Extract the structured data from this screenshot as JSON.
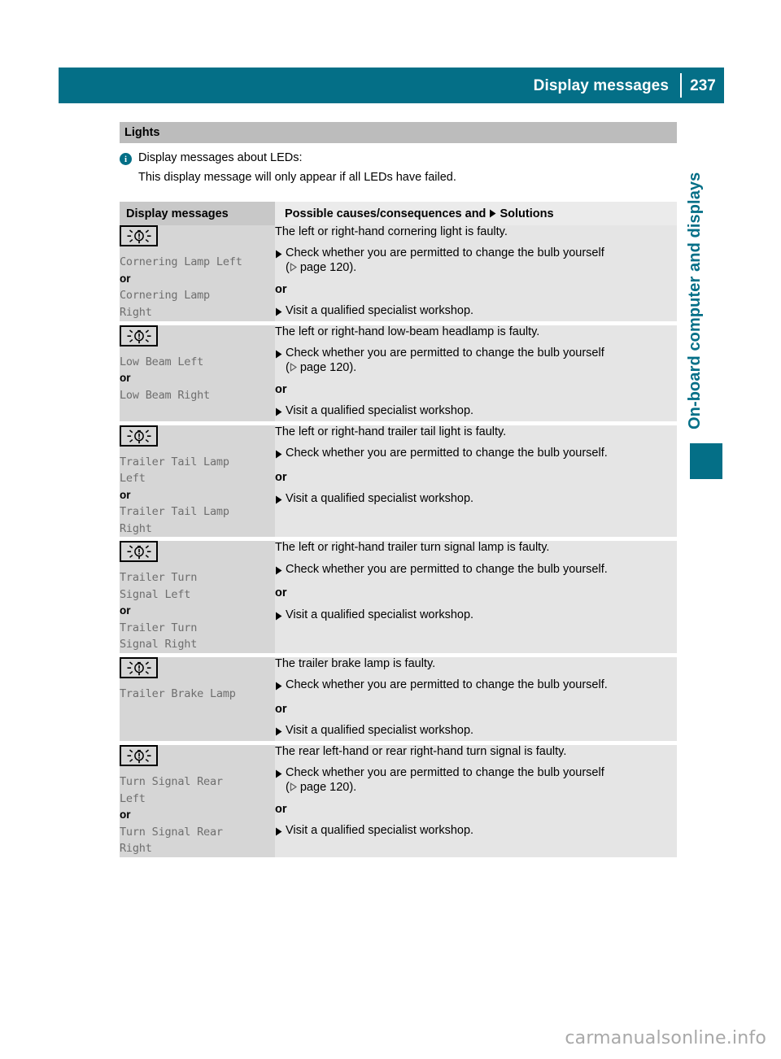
{
  "header": {
    "title": "Display messages",
    "page_number": "237"
  },
  "section": {
    "title": "Lights"
  },
  "note": {
    "icon": "info-icon",
    "line1": "Display messages about LEDs:",
    "line2": "This display message will only appear if all LEDs have failed."
  },
  "table": {
    "columns": {
      "left": "Display messages",
      "right_prefix": "Possible causes/consequences and",
      "right_suffix": "Solutions"
    },
    "or_label": "or",
    "rows": [
      {
        "icon": "bulb-warning-icon",
        "messages": [
          "Cornering Lamp Left",
          "Cornering Lamp\nRight"
        ],
        "cause": "The left or right-hand cornering light is faulty.",
        "solutions": [
          "Check whether you are permitted to change the bulb yourself",
          "Visit a qualified specialist workshop."
        ],
        "page_ref": "page 120).",
        "page_ref_prefix": "("
      },
      {
        "icon": "bulb-warning-icon",
        "messages": [
          "Low Beam Left",
          "Low Beam Right"
        ],
        "cause": "The left or right-hand low-beam headlamp is faulty.",
        "solutions": [
          "Check whether you are permitted to change the bulb yourself",
          "Visit a qualified specialist workshop."
        ],
        "page_ref": "page 120).",
        "page_ref_prefix": "("
      },
      {
        "icon": "bulb-warning-icon",
        "messages": [
          "Trailer Tail Lamp\nLeft",
          "Trailer Tail Lamp\nRight"
        ],
        "cause": "The left or right-hand trailer tail light is faulty.",
        "solutions": [
          "Check whether you are permitted to change the bulb yourself.",
          "Visit a qualified specialist workshop."
        ],
        "page_ref": "",
        "page_ref_prefix": ""
      },
      {
        "icon": "bulb-warning-icon",
        "messages": [
          "Trailer Turn\nSignal Left",
          "Trailer Turn\nSignal Right"
        ],
        "cause": "The left or right-hand trailer turn signal lamp is faulty.",
        "solutions": [
          "Check whether you are permitted to change the bulb yourself.",
          "Visit a qualified specialist workshop."
        ],
        "page_ref": "",
        "page_ref_prefix": ""
      },
      {
        "icon": "bulb-warning-icon",
        "messages": [
          "Trailer Brake Lamp"
        ],
        "cause": "The trailer brake lamp is faulty.",
        "solutions": [
          "Check whether you are permitted to change the bulb yourself.",
          "Visit a qualified specialist workshop."
        ],
        "page_ref": "",
        "page_ref_prefix": ""
      },
      {
        "icon": "bulb-warning-icon",
        "messages": [
          "Turn Signal Rear\nLeft",
          "Turn Signal Rear\nRight"
        ],
        "cause": "The rear left-hand or rear right-hand turn signal is faulty.",
        "solutions": [
          "Check whether you are permitted to change the bulb yourself",
          "Visit a qualified specialist workshop."
        ],
        "page_ref": "page 120).",
        "page_ref_prefix": "("
      }
    ]
  },
  "sidebar": {
    "chapter_label": "On-board computer and displays"
  },
  "footer": {
    "watermark": "carmanualsonline.info"
  },
  "colors": {
    "accent": "#046f87",
    "section_band": "#bcbcbc",
    "col_left_header": "#c8c8c8",
    "col_right_header": "#ebebeb",
    "col_left_cell": "#d6d6d6",
    "col_right_cell": "#e5e5e5",
    "mono_text": "#6e6e6e",
    "watermark": "#a8a8a8"
  }
}
